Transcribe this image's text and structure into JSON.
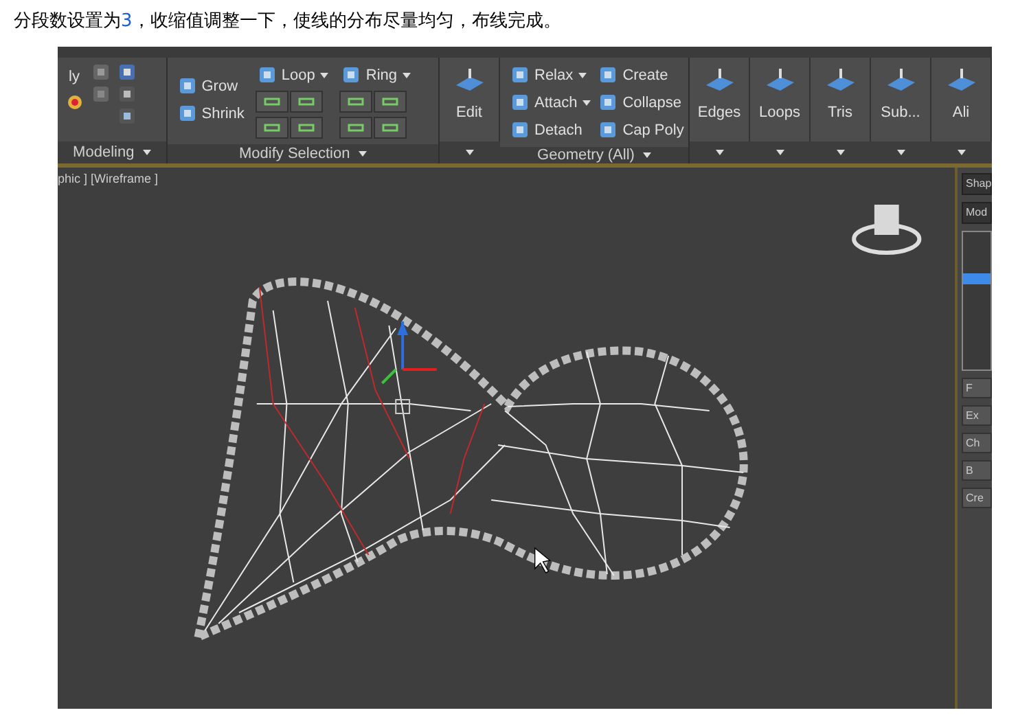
{
  "caption": {
    "before": "分段数设置为",
    "number": "3",
    "after": "，收缩值调整一下，使线的分布尽量均匀，布线完成。"
  },
  "ribbon": {
    "panels": [
      {
        "kind": "modeling",
        "title": "Modeling",
        "items": [
          {
            "label": "ly"
          }
        ]
      },
      {
        "kind": "small",
        "title": "Modify Selection",
        "items": [
          {
            "label": "Grow",
            "dropdown": false
          },
          {
            "label": "Shrink",
            "dropdown": false
          },
          {
            "label": "Loop",
            "dropdown": true
          },
          {
            "label": "Ring",
            "dropdown": true
          }
        ]
      },
      {
        "kind": "large",
        "items": [
          {
            "label": "Edit"
          }
        ]
      },
      {
        "kind": "small",
        "title": "Geometry (All)",
        "items": [
          {
            "label": "Relax",
            "dropdown": true
          },
          {
            "label": "Attach",
            "dropdown": true
          },
          {
            "label": "Detach",
            "dropdown": false
          },
          {
            "label": "Create",
            "dropdown": false
          },
          {
            "label": "Collapse",
            "dropdown": false
          },
          {
            "label": "Cap Poly",
            "dropdown": false
          }
        ]
      },
      {
        "kind": "large",
        "items": [
          {
            "label": "Edges"
          },
          {
            "label": "Loops"
          },
          {
            "label": "Tris"
          },
          {
            "label": "Sub..."
          },
          {
            "label": "Ali"
          }
        ]
      }
    ]
  },
  "viewport": {
    "label": "phic ] [Wireframe ]"
  },
  "command_panel": {
    "dropdowns": [
      "Shap",
      "Mod"
    ],
    "buttons": [
      "F",
      "Ex",
      "Ch",
      "B",
      "Cre"
    ]
  }
}
